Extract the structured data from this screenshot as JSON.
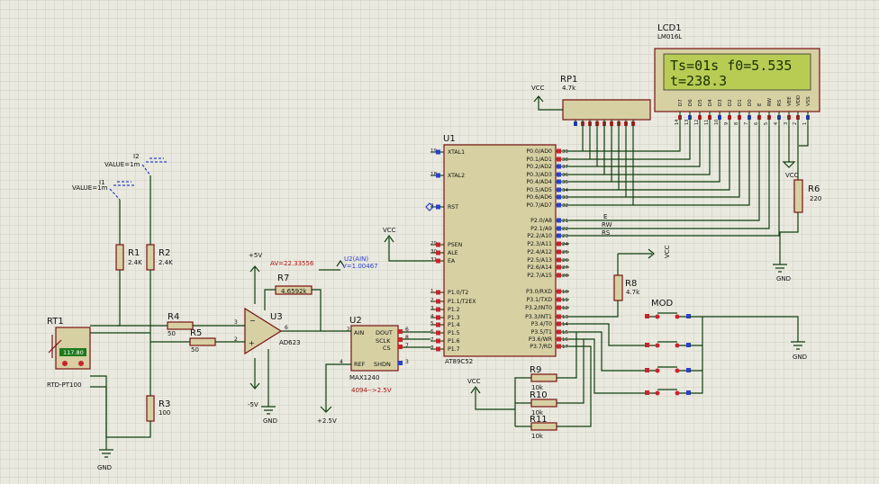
{
  "labels": {
    "lcd1": "LCD1",
    "lcd1_model": "LM016L",
    "lcd_line1": "Ts=01s  f0=5.535",
    "lcd_line2": "t=238.3",
    "lcd_pins": [
      "VSS",
      "VDD",
      "VEE",
      "RS",
      "RW",
      "E",
      "D0",
      "D1",
      "D2",
      "D3",
      "D4",
      "D5",
      "D6",
      "D7"
    ],
    "lcd_pin_nums": [
      "1",
      "2",
      "3",
      "4",
      "5",
      "6",
      "7",
      "8",
      "9",
      "10",
      "11",
      "12",
      "13",
      "14"
    ],
    "rp1": "RP1",
    "rp1_val": "4.7k",
    "vcc": "VCC",
    "gnd": "GND",
    "u1": "U1",
    "u1_part": "AT89C52",
    "u1_left_pins": [
      {
        "n": "19",
        "t": "XTAL1"
      },
      {
        "n": "18",
        "t": "XTAL2"
      },
      {
        "n": "9",
        "t": "RST"
      },
      {
        "n": "29",
        "t": "PSEN"
      },
      {
        "n": "30",
        "t": "ALE"
      },
      {
        "n": "31",
        "t": "EA"
      },
      {
        "n": "1",
        "t": "P1.0/T2"
      },
      {
        "n": "2",
        "t": "P1.1/T2EX"
      },
      {
        "n": "3",
        "t": "P1.2"
      },
      {
        "n": "4",
        "t": "P1.3"
      },
      {
        "n": "5",
        "t": "P1.4"
      },
      {
        "n": "6",
        "t": "P1.5"
      },
      {
        "n": "7",
        "t": "P1.6"
      },
      {
        "n": "8",
        "t": "P1.7"
      }
    ],
    "u1_right_pins": [
      {
        "n": "39",
        "t": "P0.0/AD0"
      },
      {
        "n": "38",
        "t": "P0.1/AD1"
      },
      {
        "n": "37",
        "t": "P0.2/AD2"
      },
      {
        "n": "36",
        "t": "P0.3/AD3"
      },
      {
        "n": "35",
        "t": "P0.4/AD4"
      },
      {
        "n": "34",
        "t": "P0.5/AD5"
      },
      {
        "n": "33",
        "t": "P0.6/AD6"
      },
      {
        "n": "32",
        "t": "P0.7/AD7"
      },
      {
        "n": "21",
        "t": "P2.0/A8"
      },
      {
        "n": "22",
        "t": "P2.1/A9"
      },
      {
        "n": "23",
        "t": "P2.2/A10"
      },
      {
        "n": "24",
        "t": "P2.3/A11"
      },
      {
        "n": "25",
        "t": "P2.4/A12"
      },
      {
        "n": "26",
        "t": "P2.5/A13"
      },
      {
        "n": "27",
        "t": "P2.6/A14"
      },
      {
        "n": "28",
        "t": "P2.7/A15"
      },
      {
        "n": "10",
        "t": "P3.0/RXD"
      },
      {
        "n": "11",
        "t": "P3.1/TXD"
      },
      {
        "n": "12",
        "t": "P3.2/INT0"
      },
      {
        "n": "13",
        "t": "P3.3/INT1"
      },
      {
        "n": "14",
        "t": "P3.4/T0"
      },
      {
        "n": "15",
        "t": "P3.5/T1"
      },
      {
        "n": "16",
        "t": "P3.6/WR"
      },
      {
        "n": "17",
        "t": "P3.7/RD"
      }
    ],
    "net_e": "E",
    "net_rw": "RW",
    "net_rs": "RS",
    "r6": "R6",
    "r6_val": "220",
    "r8": "R8",
    "r8_val": "4.7k",
    "mod": "MOD",
    "r9": "R9",
    "r10": "R10",
    "r11": "R11",
    "r_10k": "10k",
    "u2": "U2",
    "u2_part": "MAX1240",
    "u2_pins": {
      "ain": "AIN",
      "dout": "DOUT",
      "sclk": "SCLK",
      "cs": "CS",
      "ref": "REF",
      "shdn": "SHDN"
    },
    "u2_pin_nums": {
      "ain": "2",
      "dout": "6",
      "sclk": "8",
      "cs": "7",
      "ref": "4",
      "shdn": "3"
    },
    "u2_note": "4094-->2.5V",
    "v_2_5": "+2.5V",
    "u3": "U3",
    "u3_part": "AD623",
    "av": "AV=22.33556",
    "u2ain_probe": "U2(AIN)",
    "u2ain_val": "V=1.00467",
    "v_p5": "+5V",
    "v_m5": "-5V",
    "r7": "R7",
    "r7_val": "4.6592k",
    "r4": "R4",
    "r4_val": "50",
    "r5": "R5",
    "r5_val": "50",
    "r1": "R1",
    "r1_val": "2.4K",
    "r2": "R2",
    "r2_val": "2.4K",
    "r3": "R3",
    "r3_val": "100",
    "i1": "I1",
    "i1_val": "VALUE=1m",
    "i2": "I2",
    "i2_val": "VALUE=1m",
    "rt1": "RT1",
    "rt1_part": "RTD-PT100",
    "rt1_reading": "117.80",
    "op_pins": {
      "inv": "3",
      "noninv": "2",
      "out": "6"
    }
  },
  "colors": {
    "background": "#e9e9df",
    "grid": "#c6c6b8",
    "wire": "#0f3f0f",
    "component_body": "#d7d0a3",
    "component_border": "#7a1212",
    "lcd_screen": "#b8cc54",
    "pin_high": "#d0202c",
    "pin_low": "#2a3fd0"
  }
}
